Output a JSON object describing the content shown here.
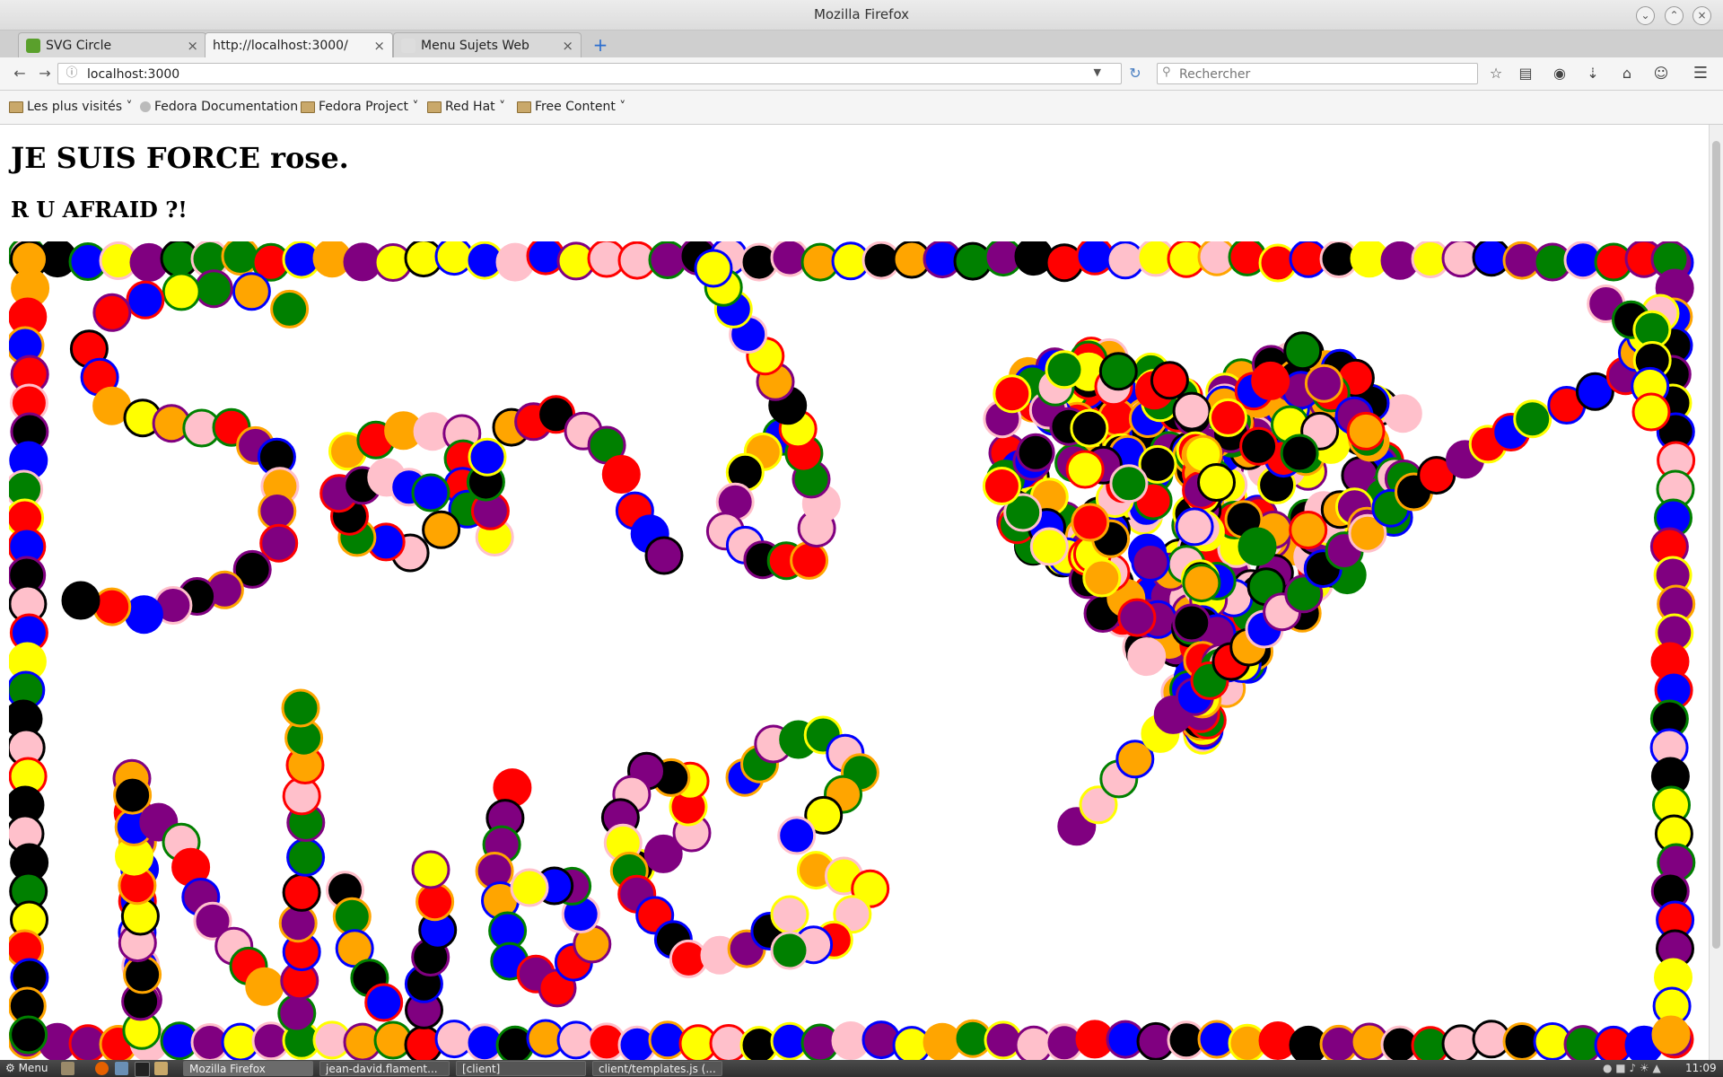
{
  "window": {
    "title": "Mozilla Firefox"
  },
  "tabs": [
    {
      "label": "SVG Circle",
      "active": false
    },
    {
      "label": "http://localhost:3000/",
      "active": true
    },
    {
      "label": "Menu Sujets Web",
      "active": false
    }
  ],
  "navbar": {
    "url": "localhost:3000",
    "search_placeholder": "Rechercher"
  },
  "bookmarks": [
    {
      "label": "Les plus visités",
      "dropdown": true
    },
    {
      "label": "Fedora Documentation",
      "dropdown": false
    },
    {
      "label": "Fedora Project",
      "dropdown": true
    },
    {
      "label": "Red Hat",
      "dropdown": true
    },
    {
      "label": "Free Content",
      "dropdown": true
    }
  ],
  "page": {
    "heading": "JE SUIS FORCE rose.",
    "subheading": "R U AFRAID ?!"
  },
  "drawing": {
    "palette": [
      "#ff0000",
      "#0000ff",
      "#008000",
      "#ffff00",
      "#ffa500",
      "#800080",
      "#000000",
      "#ffc0cb"
    ]
  },
  "taskbar": {
    "menu_label": "Menu",
    "windows": [
      {
        "label": "Mozilla Firefox",
        "active": true
      },
      {
        "label": "jean-david.flament...",
        "active": false
      },
      {
        "label": "[client]",
        "active": false
      },
      {
        "label": "client/templates.js (...",
        "active": false
      }
    ],
    "clock": "11:09"
  },
  "colors": {
    "accent": "#2b6ecf"
  }
}
